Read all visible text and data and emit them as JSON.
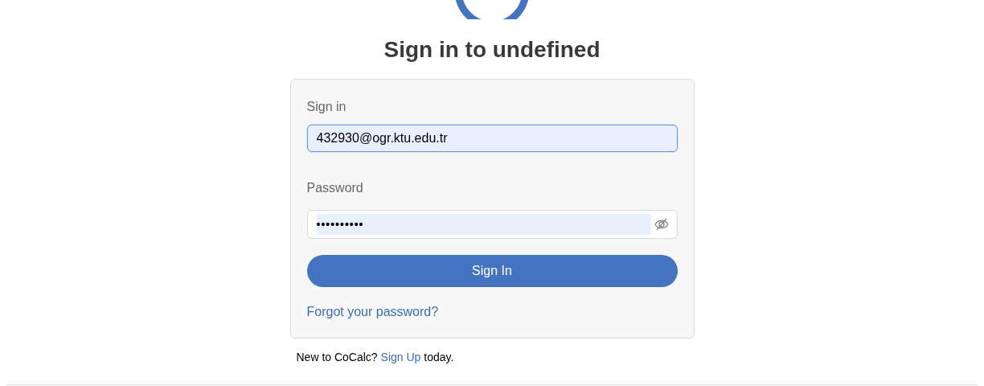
{
  "title": "Sign in to undefined",
  "form": {
    "email_label": "Sign in",
    "email_value": "432930@ogr.ktu.edu.tr",
    "email_focused": true,
    "password_label": "Password",
    "password_value": "••••••••••",
    "password_visible": false,
    "submit": "Sign In",
    "forgot_link": "Forgot your password?"
  },
  "footer": {
    "prefix": "New to CoCalc?",
    "link": "Sign Up",
    "suffix": "today."
  }
}
